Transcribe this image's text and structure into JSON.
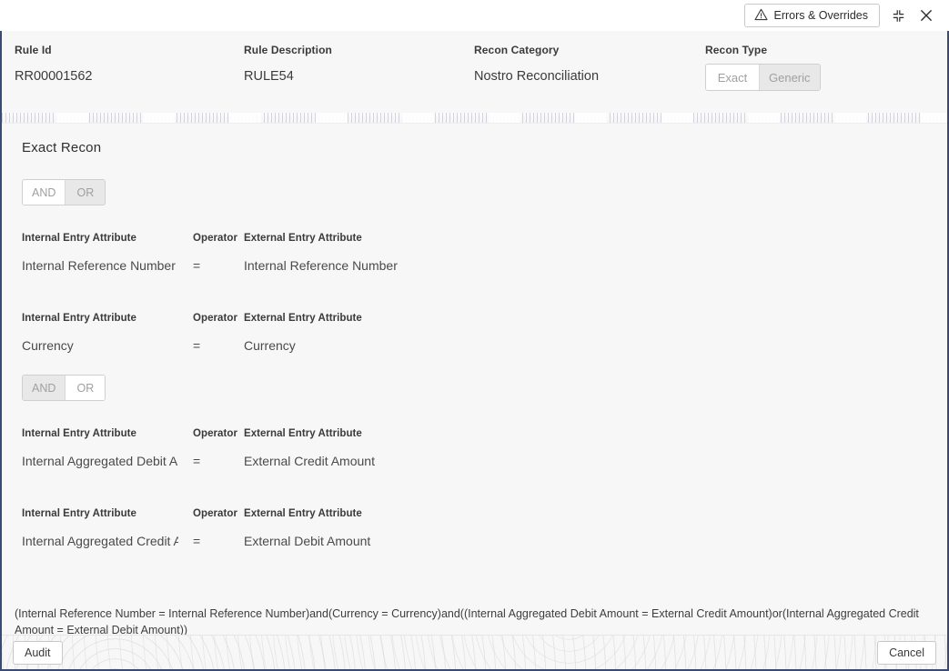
{
  "topbar": {
    "errors_overrides_label": "Errors & Overrides",
    "warning_icon": "warning-triangle-icon",
    "minimize_icon": "collapse-icon",
    "close_icon": "close-icon"
  },
  "summary": {
    "fields": [
      {
        "label": "Rule Id",
        "value": "RR00001562"
      },
      {
        "label": "Rule Description",
        "value": "RULE54"
      },
      {
        "label": "Recon Category",
        "value": "Nostro Reconciliation"
      }
    ],
    "recon_type": {
      "label": "Recon Type",
      "options": [
        "Exact",
        "Generic"
      ],
      "selected": "Exact"
    }
  },
  "panel": {
    "title": "Exact Recon",
    "groups": [
      {
        "logic": {
          "options": [
            "AND",
            "OR"
          ],
          "selected": "AND"
        },
        "conditions": [
          {
            "internal_header": "Internal Entry Attribute",
            "internal_value": "Internal Reference Number",
            "operator_header": "Operator",
            "operator_value": "=",
            "external_header": "External Entry Attribute",
            "external_value": "Internal Reference Number"
          },
          {
            "internal_header": "Internal Entry Attribute",
            "internal_value": "Currency",
            "operator_header": "Operator",
            "operator_value": "=",
            "external_header": "External Entry Attribute",
            "external_value": "Currency"
          }
        ]
      },
      {
        "logic": {
          "options": [
            "AND",
            "OR"
          ],
          "selected": "OR"
        },
        "conditions": [
          {
            "internal_header": "Internal Entry Attribute",
            "internal_value": "Internal Aggregated Debit Amount",
            "operator_header": "Operator",
            "operator_value": "=",
            "external_header": "External Entry Attribute",
            "external_value": "External Credit Amount"
          },
          {
            "internal_header": "Internal Entry Attribute",
            "internal_value": "Internal Aggregated Credit Amount",
            "operator_header": "Operator",
            "operator_value": "=",
            "external_header": "External Entry Attribute",
            "external_value": "External Debit Amount"
          }
        ]
      }
    ]
  },
  "expression": "(Internal Reference Number = Internal Reference Number)and(Currency = Currency)and((Internal Aggregated Debit Amount = External Credit Amount)or(Internal Aggregated Credit Amount = External Debit Amount))",
  "footer": {
    "audit_label": "Audit",
    "cancel_label": "Cancel"
  },
  "colors": {
    "frame_border": "#3b4a73",
    "panel_background": "#f7f7f7",
    "segment_off": "#e8e8e8",
    "muted_text": "#a0a0a0"
  }
}
